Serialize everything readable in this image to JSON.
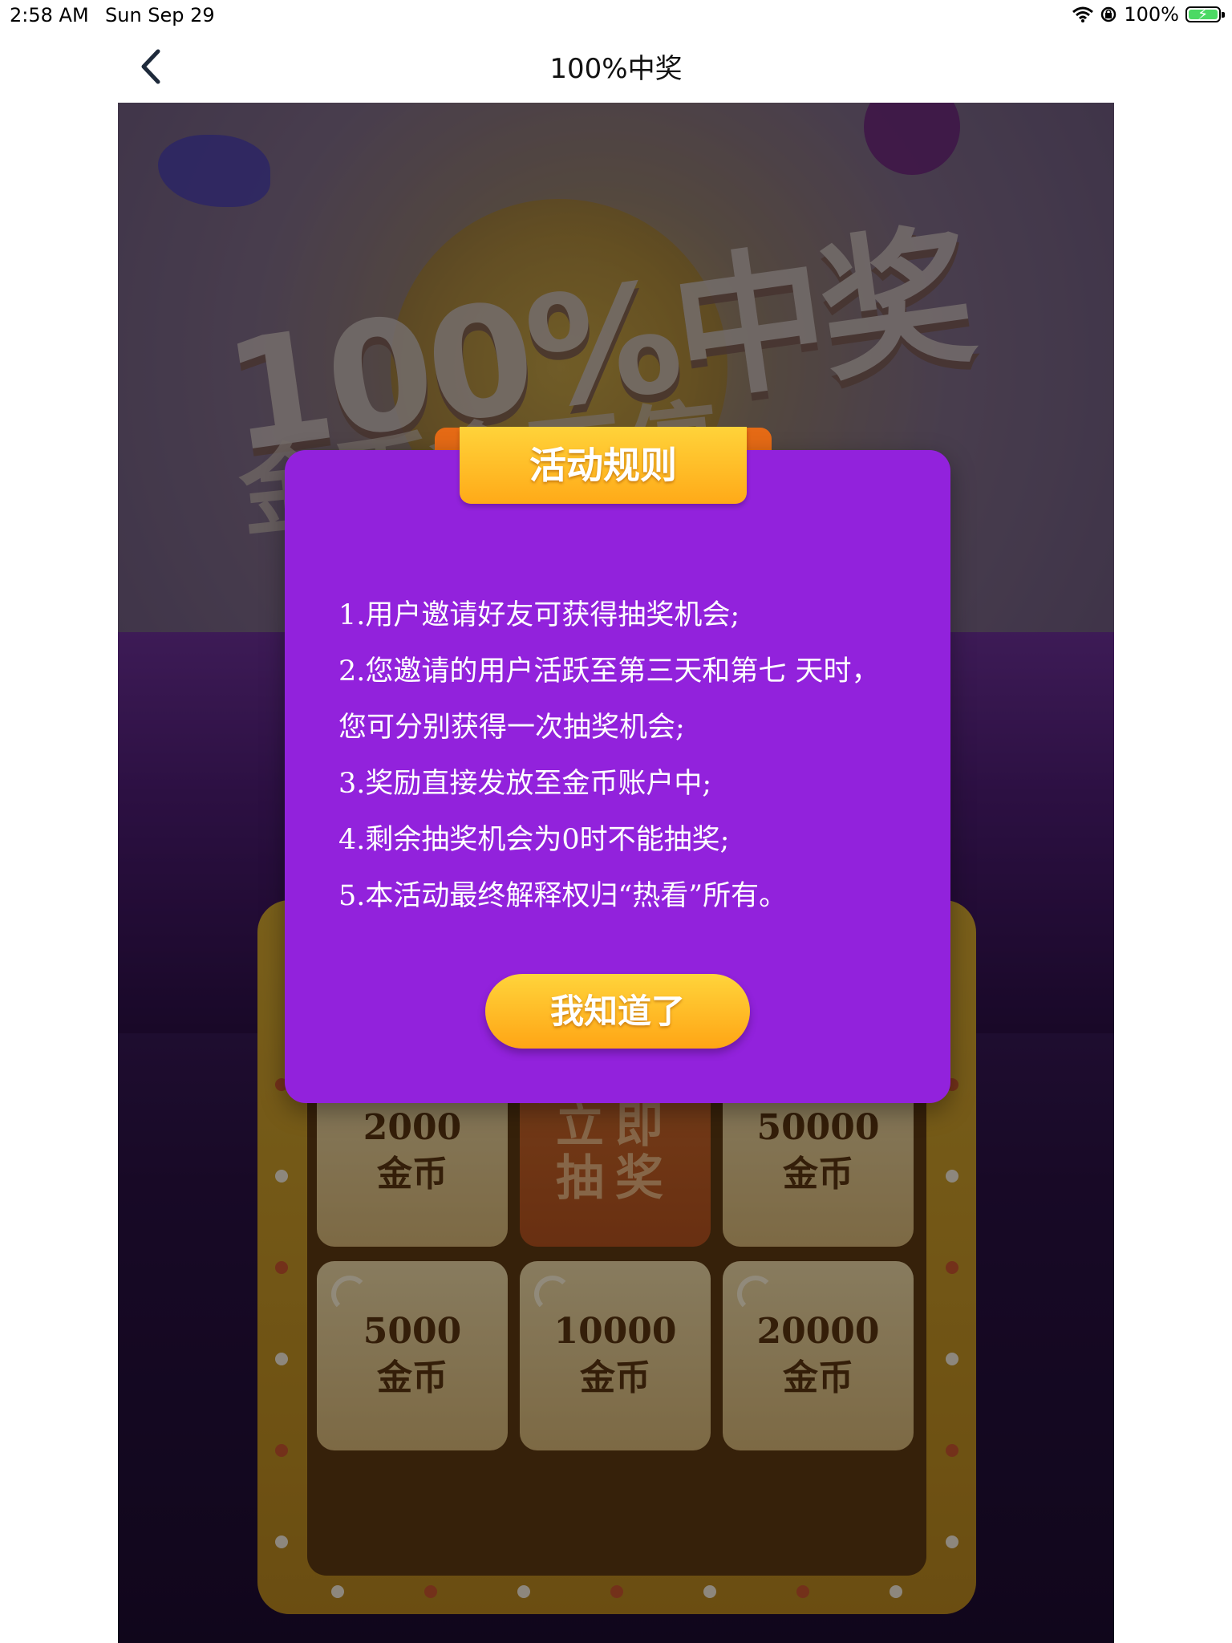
{
  "status_bar": {
    "time": "2:58 AM",
    "date": "Sun Sep 29",
    "battery_percent": "100%"
  },
  "nav": {
    "title": "100%中奖"
  },
  "banner": {
    "headline": "100%中奖",
    "subline": "金币拿不停"
  },
  "board": {
    "cells": [
      {
        "amount": "2000",
        "unit": "金币"
      },
      {
        "draw_line1": "立即",
        "draw_line2": "抽奖"
      },
      {
        "amount": "50000",
        "unit": "金币"
      },
      {
        "amount": "5000",
        "unit": "金币"
      },
      {
        "amount": "10000",
        "unit": "金币"
      },
      {
        "amount": "20000",
        "unit": "金币"
      }
    ]
  },
  "modal": {
    "title": "活动规则",
    "rules": [
      "1.用户邀请好友可获得抽奖机会;",
      "2.您邀请的用户活跃至第三天和第七 天时，您可分别获得一次抽奖机会;",
      "3.奖励直接发放至金币账户中;",
      "4.剩余抽奖机会为0时不能抽奖;",
      "5.本活动最终解释权归“热看”所有。"
    ],
    "confirm_label": "我知道了"
  },
  "colors": {
    "modal_bg": "#9222dc",
    "button_gold": "#ffaa18",
    "tab_orange": "#e56a15"
  }
}
